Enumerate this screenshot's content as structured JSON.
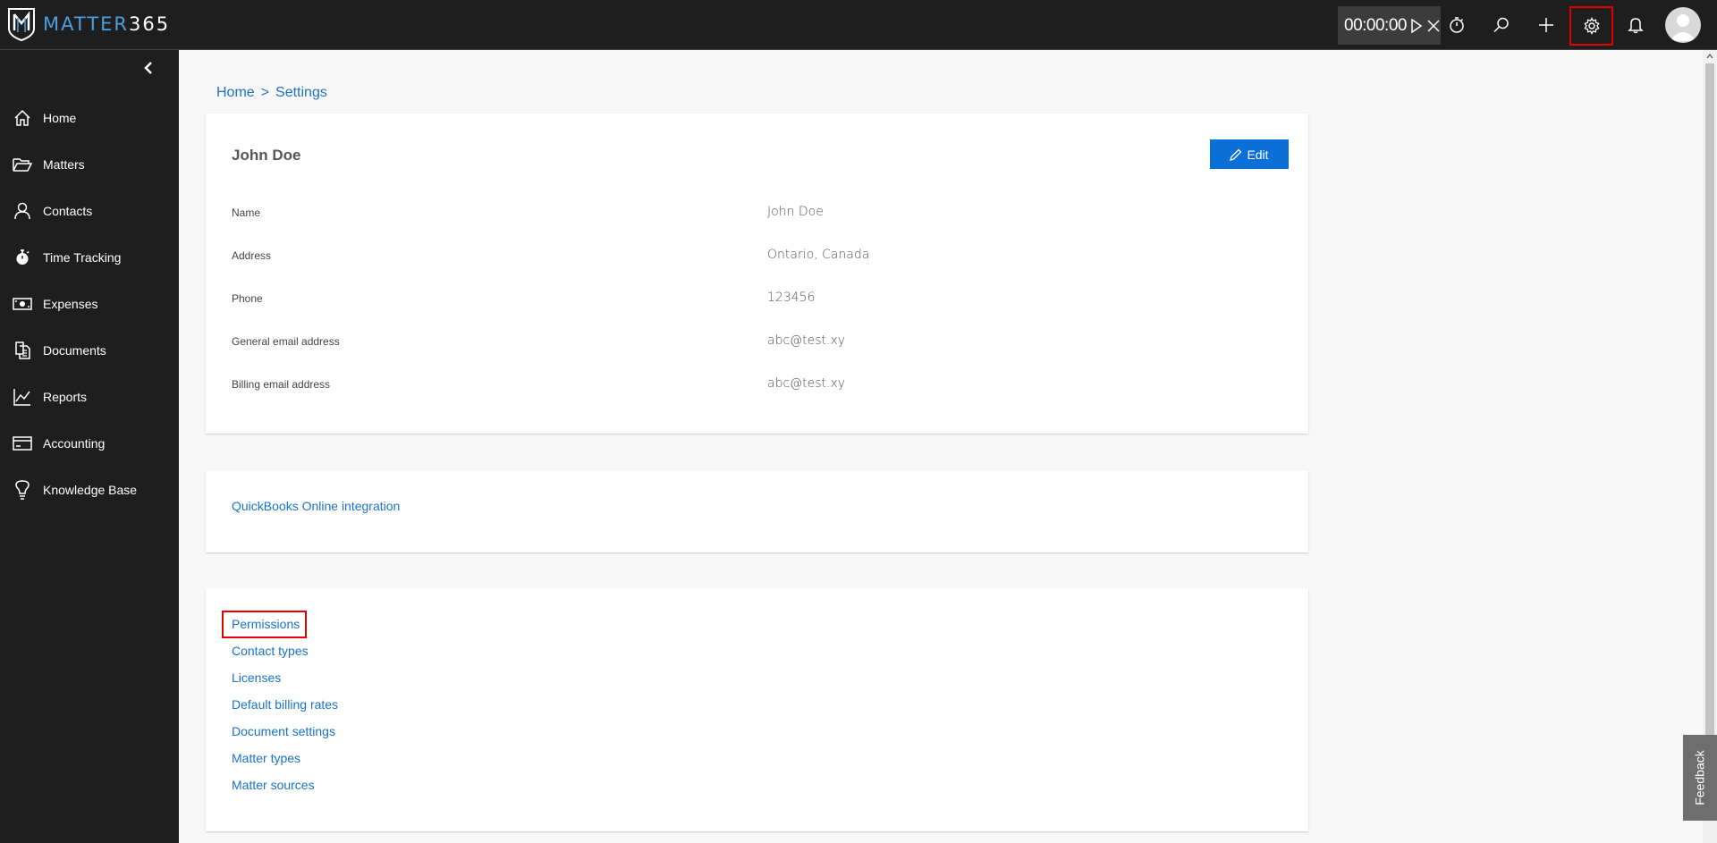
{
  "app": {
    "logo_text_accent": "MATTER",
    "logo_text_number": "365",
    "accent_color": "#0a6fd8",
    "link_color": "#1a73c8",
    "highlight_color": "#e00000"
  },
  "topbar": {
    "timer_value": "00:00:00",
    "icons": [
      "play-icon",
      "close-icon",
      "stopwatch-icon",
      "search-icon",
      "plus-icon",
      "gear-icon",
      "bell-icon",
      "avatar"
    ]
  },
  "sidebar": {
    "items": [
      {
        "label": "Home",
        "icon": "home-icon"
      },
      {
        "label": "Matters",
        "icon": "folder-open-icon"
      },
      {
        "label": "Contacts",
        "icon": "person-icon"
      },
      {
        "label": "Time Tracking",
        "icon": "stopwatch-icon"
      },
      {
        "label": "Expenses",
        "icon": "money-icon"
      },
      {
        "label": "Documents",
        "icon": "documents-icon"
      },
      {
        "label": "Reports",
        "icon": "chart-icon"
      },
      {
        "label": "Accounting",
        "icon": "card-icon"
      },
      {
        "label": "Knowledge Base",
        "icon": "lightbulb-icon"
      }
    ]
  },
  "breadcrumb": {
    "home": "Home",
    "separator": ">",
    "current": "Settings"
  },
  "profile": {
    "name": "John Doe",
    "edit_label": "Edit",
    "fields": [
      {
        "label": "Name",
        "value": "John Doe"
      },
      {
        "label": "Address",
        "value": "Ontario, Canada"
      },
      {
        "label": "Phone",
        "value": "123456"
      },
      {
        "label": "General email address",
        "value": "abc@test.xy"
      },
      {
        "label": "Billing email address",
        "value": "abc@test.xy"
      }
    ]
  },
  "integrations": {
    "quickbooks": "QuickBooks Online integration"
  },
  "settings_links": [
    "Permissions",
    "Contact types",
    "Licenses",
    "Default billing rates",
    "Document settings",
    "Matter types",
    "Matter sources"
  ],
  "feedback_label": "Feedback"
}
